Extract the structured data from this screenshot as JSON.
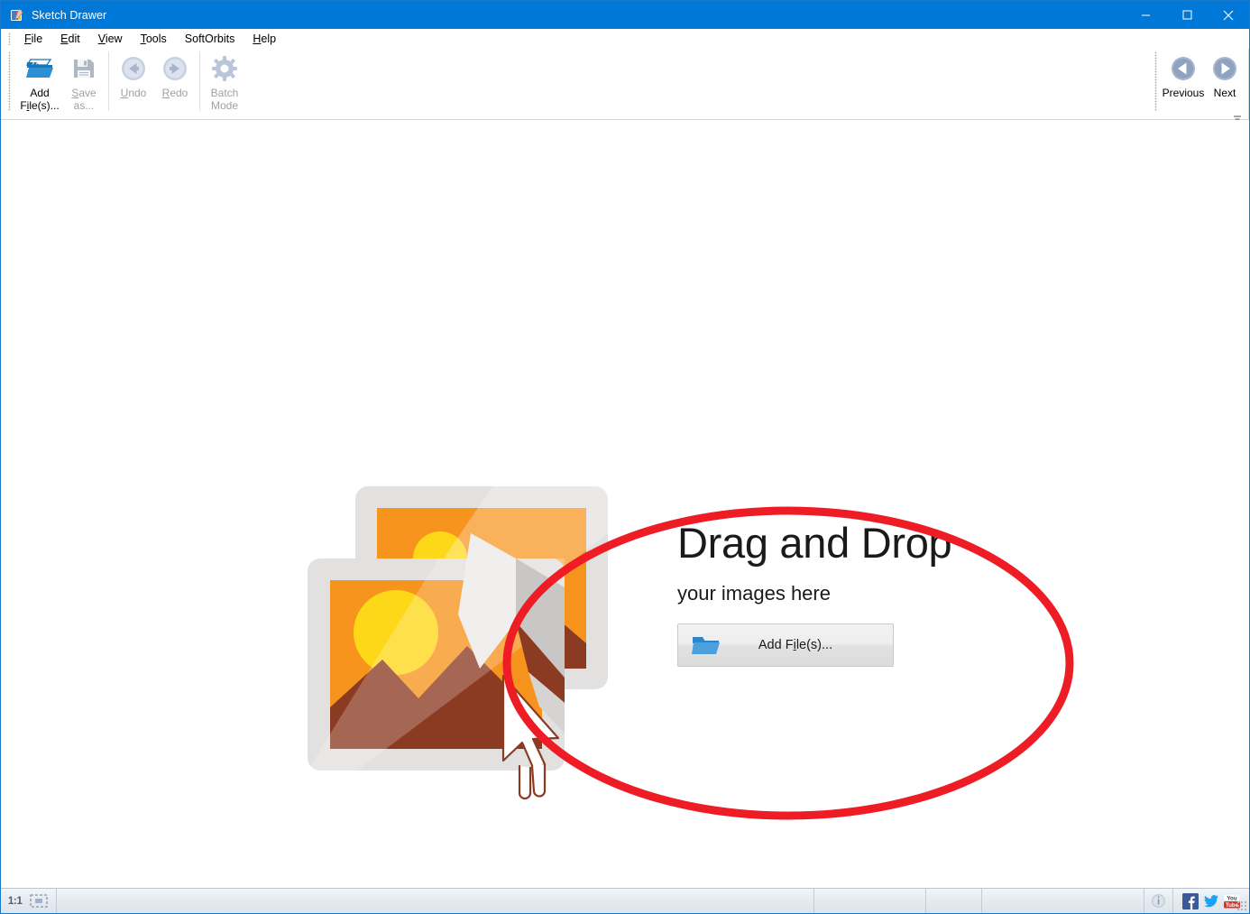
{
  "window": {
    "title": "Sketch Drawer",
    "app_icon": "sketch-drawer-app-icon",
    "controls": {
      "minimize": "minimize-icon",
      "maximize": "maximize-icon",
      "close": "close-icon"
    },
    "titlebar_color": "#0078d7",
    "titlebar_text_color": "#ffffff"
  },
  "menubar": {
    "items": [
      {
        "pre": "",
        "mn": "F",
        "post": "ile"
      },
      {
        "pre": "",
        "mn": "E",
        "post": "dit"
      },
      {
        "pre": "",
        "mn": "V",
        "post": "iew"
      },
      {
        "pre": "",
        "mn": "T",
        "post": "ools"
      },
      {
        "pre": "SoftOrbits",
        "mn": "",
        "post": ""
      },
      {
        "pre": "",
        "mn": "H",
        "post": "elp"
      }
    ]
  },
  "toolbar": {
    "left_buttons": [
      {
        "name": "add-files",
        "icon": "open-folder-icon",
        "line1_pre": "Add",
        "line1_mn": "",
        "line1_post": "",
        "line2_pre": "F",
        "line2_mn": "i",
        "line2_post": "le(s)...",
        "enabled": true
      },
      {
        "name": "save-as",
        "icon": "floppy-disk-icon",
        "line1_pre": "",
        "line1_mn": "S",
        "line1_post": "ave",
        "line2_pre": "as...",
        "line2_mn": "",
        "line2_post": "",
        "enabled": false
      },
      {
        "name": "undo",
        "icon": "undo-arrow-icon",
        "line1_pre": "",
        "line1_mn": "U",
        "line1_post": "ndo",
        "line2_pre": "",
        "line2_mn": "",
        "line2_post": "",
        "enabled": false
      },
      {
        "name": "redo",
        "icon": "redo-arrow-icon",
        "line1_pre": "",
        "line1_mn": "R",
        "line1_post": "edo",
        "line2_pre": "",
        "line2_mn": "",
        "line2_post": "",
        "enabled": false
      },
      {
        "name": "batch-mode",
        "icon": "gear-icon",
        "line1_pre": "Batch",
        "line1_mn": "",
        "line1_post": "",
        "line2_pre": "Mode",
        "line2_mn": "",
        "line2_post": "",
        "enabled": false
      }
    ],
    "right_buttons": [
      {
        "name": "previous",
        "icon": "arrow-left-circle-icon",
        "label": "Previous",
        "enabled": true
      },
      {
        "name": "next",
        "icon": "arrow-right-circle-icon",
        "label": "Next",
        "enabled": true
      }
    ],
    "overflow_icon": "toolbar-overflow-chevron-icon"
  },
  "canvas": {
    "illustration": {
      "icon": "image-stack-illustration",
      "cursor_icon": "mouse-pointer-outline-icon",
      "colors": {
        "frame": "#e3e1df",
        "frame_shadow": "#c9c7c5",
        "sky": "#f7941e",
        "sky_light": "#fba027",
        "sun": "#fdd819",
        "mountain": "#8c3b23",
        "paper": "#f0efee",
        "paper_shadow": "#bfbdbb"
      }
    },
    "promo": {
      "title": "Drag and Drop",
      "subtitle": "your images here",
      "button": {
        "icon": "open-folder-icon",
        "pre": "Add F",
        "mn": "i",
        "post": "le(s)..."
      }
    },
    "annotation": {
      "shape": "ellipse-highlight",
      "color": "#ee1c24",
      "stroke_width": 9
    }
  },
  "statusbar": {
    "zoom_label": "1:1",
    "fit_icon": "fit-to-window-icon",
    "panels": [
      "",
      "",
      "",
      ""
    ],
    "info_icon": "info-icon",
    "social": [
      {
        "name": "facebook-icon",
        "color": "#3b5998"
      },
      {
        "name": "twitter-icon",
        "color": "#1da1f2"
      },
      {
        "name": "youtube-icon",
        "color": "#e52d27"
      }
    ],
    "resize_grip": "resize-grip-icon"
  }
}
